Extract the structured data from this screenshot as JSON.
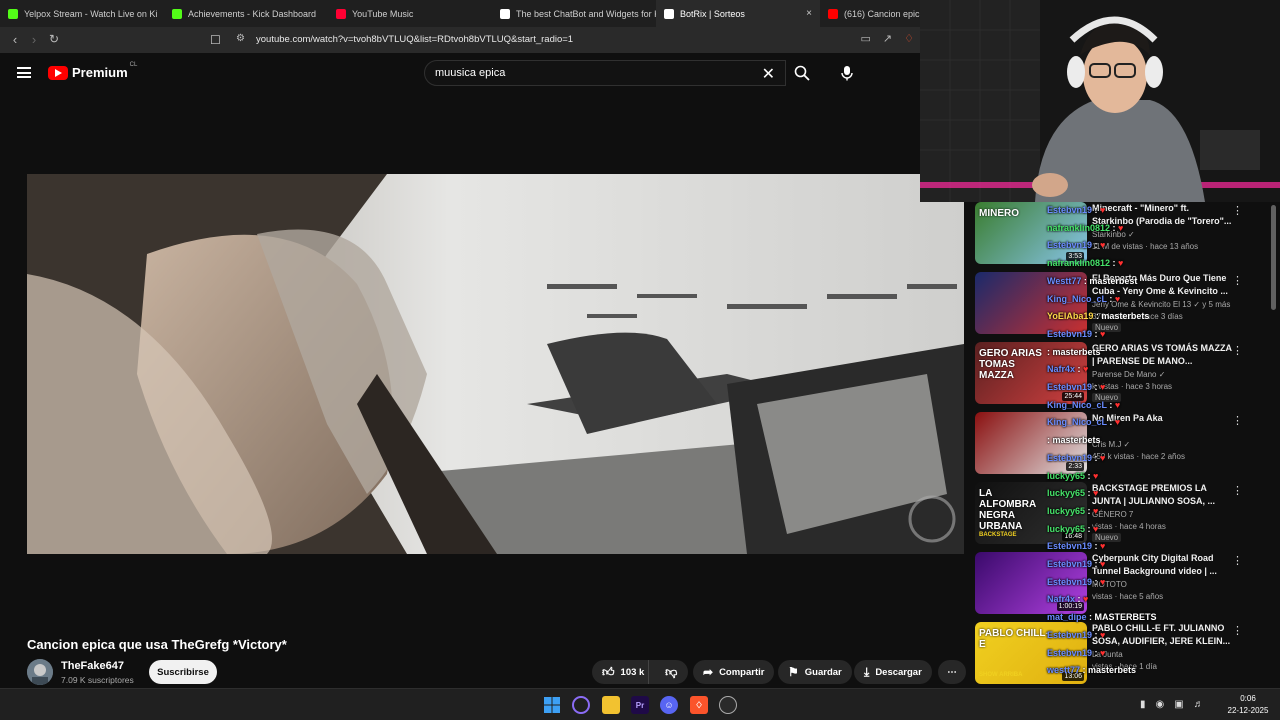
{
  "browser": {
    "tabs": [
      {
        "label": "Yelpox Stream - Watch Live on Ki",
        "color": "#53fc18"
      },
      {
        "label": "Achievements - Kick Dashboard",
        "color": "#53fc18"
      },
      {
        "label": "YouTube Music",
        "color": "#ff0033"
      },
      {
        "label": "The best ChatBot and Widgets for Ki",
        "color": "#ffffff"
      },
      {
        "label": "BotRix | Sorteos",
        "color": "#ffffff",
        "active": true,
        "close": "×"
      },
      {
        "label": "(616) Cancion epic",
        "color": "#ff0000"
      }
    ],
    "url": "youtube.com/watch?v=tvoh8bVTLUQ&list=RDtvoh8bVTLUQ&start_radio=1"
  },
  "header": {
    "brand": "Premium",
    "country": "CL",
    "search_value": "muusica epica"
  },
  "video": {
    "title": "Cancion epica que usa TheGrefg *Victory*",
    "channel": "TheFake647",
    "subscribers": "7.09 K suscriptores",
    "subscribe_label": "Suscribirse",
    "likes": "103 k",
    "share_label": "Compartir",
    "save_label": "Guardar",
    "download_label": "Descargar"
  },
  "recommendations": [
    {
      "title": "Minecraft - \"Minero\" ft. Starkinbo (Parodia de \"Torero\"...",
      "channel": "Starkinbo ✓",
      "meta": "11 M de vistas · hace 13 años",
      "duration": "3:53",
      "thumb_text": "MINERO",
      "colors": [
        "#3a7d2f",
        "#88c4e8"
      ]
    },
    {
      "title": "El Reparto Más Duro Que Tiene Cuba - Yeny Ome & Kevincito ...",
      "channel": "Jeny Ome & Kevincito El 13 ✓ y 5 más",
      "meta": "370 k vistas · hace 3 días",
      "badge": "Nuevo",
      "duration": "",
      "thumb_text": "",
      "colors": [
        "#1a2a6b",
        "#c93030"
      ]
    },
    {
      "title": "GERO ARIAS VS TOMÁS MAZZA | PARENSE DE MANO...",
      "channel": "Parense De Mano ✓",
      "meta": "k vistas · hace 3 horas",
      "badge": "Nuevo",
      "duration": "25:44",
      "thumb_text": "GERO ARIAS TOMAS MAZZA",
      "colors": [
        "#5a2020",
        "#d04040"
      ]
    },
    {
      "title": "No Miren Pa Aka",
      "channel": "Cris M.J ✓",
      "meta": "459 k vistas · hace 2 años",
      "duration": "2:33",
      "thumb_text": "",
      "colors": [
        "#8a1010",
        "#e0e0e0"
      ]
    },
    {
      "title": "BACKSTAGE PREMIOS LA JUNTA | JULIANNO SOSA, ...",
      "channel": "GÉNERO 7",
      "meta": "vistas · hace 4 horas",
      "badge": "Nuevo",
      "duration": "16:48",
      "thumb_text": "LA ALFOMBRA NEGRA URBANA",
      "thumb_sub": "BACKSTAGE",
      "colors": [
        "#101010",
        "#303030"
      ]
    },
    {
      "title": "Cyberpunk City Digital Road Tunnel Background video | ...",
      "channel": "MOTOTO",
      "meta": "vistas · hace 5 años",
      "duration": "1:00:19",
      "thumb_text": "",
      "colors": [
        "#3a0a6b",
        "#b040e0"
      ]
    },
    {
      "title": "PABLO CHILL-E FT. JULIANNO SOSA, AUDIFIER, JERE KLEIN...",
      "channel": "La Junta",
      "meta": "vistas · hace 1 día",
      "duration": "13:06",
      "thumb_text": "PABLO CHILL-E",
      "thumb_sub": "SHOW ARRIBA",
      "colors": [
        "#f0d020",
        "#e0b010"
      ]
    }
  ],
  "chat": [
    {
      "user": "Estebvn19",
      "text": "",
      "color": "#6a8cff"
    },
    {
      "user": "nafranklin0812",
      "text": "",
      "color": "#46e46a"
    },
    {
      "user": "Estebvn19",
      "text": "",
      "color": "#6a8cff"
    },
    {
      "user": "nafranklin0812",
      "text": "",
      "color": "#46e46a"
    },
    {
      "user": "Westt77",
      "text": "masterbest",
      "color": "#6a8cff"
    },
    {
      "user": "King_Nico_cL",
      "text": "",
      "color": "#6a8cff"
    },
    {
      "user": "YoElAba19",
      "text": "masterbets",
      "color": "#ffd84a"
    },
    {
      "user": "Estebvn19",
      "text": "",
      "color": "#6a8cff"
    },
    {
      "user": "",
      "text": "masterbets",
      "color": "#6a8cff"
    },
    {
      "user": "Nafr4x",
      "text": "",
      "color": "#6a8cff"
    },
    {
      "user": "Estebvn19",
      "text": "",
      "color": "#6a8cff"
    },
    {
      "user": "King_Nico_cL",
      "text": "",
      "color": "#6a8cff"
    },
    {
      "user": "King_Nico_cL",
      "text": "",
      "color": "#6a8cff"
    },
    {
      "user": "",
      "text": "masterbets",
      "color": "#6a8cff"
    },
    {
      "user": "Estebvn19",
      "text": "",
      "color": "#6a8cff"
    },
    {
      "user": "luckyy65",
      "text": "",
      "color": "#46e46a"
    },
    {
      "user": "luckyy65",
      "text": "",
      "color": "#46e46a"
    },
    {
      "user": "luckyy65",
      "text": "",
      "color": "#46e46a"
    },
    {
      "user": "luckyy65",
      "text": "",
      "color": "#46e46a"
    },
    {
      "user": "Estebvn19",
      "text": "",
      "color": "#6a8cff"
    },
    {
      "user": "Estebvn19",
      "text": "",
      "color": "#6a8cff"
    },
    {
      "user": "Estebvn19",
      "text": "",
      "color": "#6a8cff"
    },
    {
      "user": "Nafr4x",
      "text": "",
      "color": "#6a8cff"
    },
    {
      "user": "mat_dipe",
      "text": "MASTERBETS",
      "color": "#6a8cff"
    },
    {
      "user": "Estebvn19",
      "text": "",
      "color": "#6a8cff"
    },
    {
      "user": "Estebvn19",
      "text": "",
      "color": "#6a8cff"
    },
    {
      "user": "westt77",
      "text": "masterbets",
      "color": "#6a8cff"
    }
  ],
  "taskbar": {
    "time": "0:06",
    "date": "22-12-2025"
  }
}
